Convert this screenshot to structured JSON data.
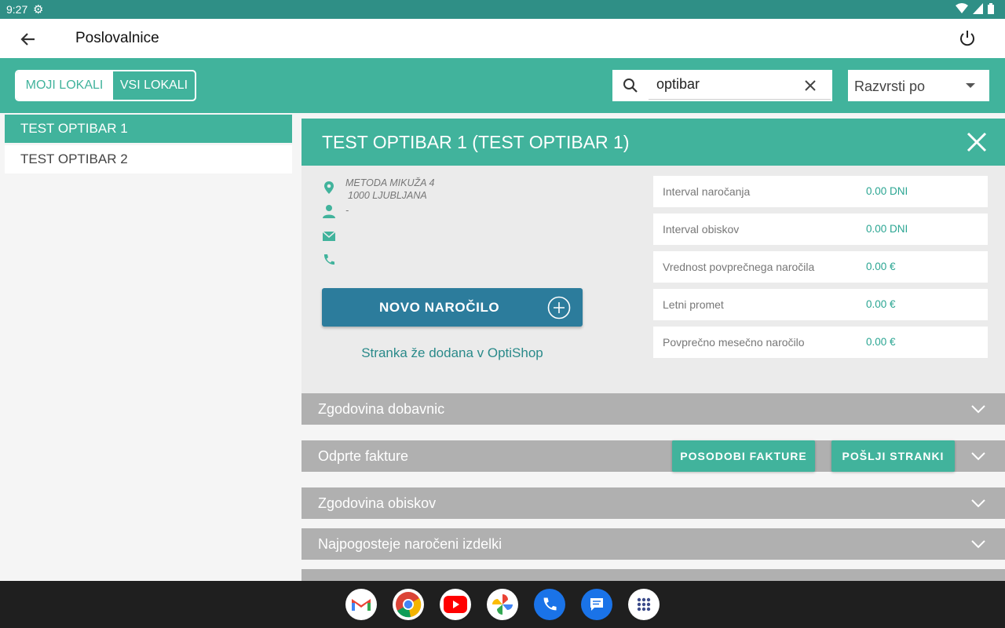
{
  "status_bar": {
    "time": "9:27"
  },
  "app_bar": {
    "title": "Poslovalnice"
  },
  "toolbar": {
    "tabs": [
      "MOJI LOKALI",
      "VSI LOKALI"
    ],
    "search_value": "optibar",
    "sort_label": "Razvrsti po"
  },
  "list": {
    "items": [
      "TEST OPTIBAR 1",
      "TEST OPTIBAR 2"
    ]
  },
  "detail": {
    "title": "TEST OPTIBAR 1 (TEST OPTIBAR 1)",
    "address_line1": "METODA MIKUŽA 4",
    "address_line2": "1000 LJUBLJANA",
    "contact_person": "-",
    "email": "",
    "phone": "",
    "order_button": "NOVO NAROČILO",
    "status_link": "Stranka že dodana v OptiShop",
    "stats": [
      {
        "label": "Interval naročanja",
        "value": "0.00 DNI"
      },
      {
        "label": "Interval obiskov",
        "value": "0.00 DNI"
      },
      {
        "label": "Vrednost povprečnega naročila",
        "value": "0.00 €"
      },
      {
        "label": "Letni promet",
        "value": "0.00 €"
      },
      {
        "label": "Povprečno mesečno naročilo",
        "value": "0.00 €"
      }
    ]
  },
  "sections": [
    {
      "title": "Zgodovina dobavnic"
    },
    {
      "title": "Odprte fakture",
      "buttons": [
        "POSODOBI FAKTURE",
        "POŠLJI STRANKI"
      ]
    },
    {
      "title": "Zgodovina obiskov"
    },
    {
      "title": "Najpogosteje naročeni izdelki"
    }
  ],
  "dock": {
    "apps": [
      "gmail-icon",
      "chrome-icon",
      "youtube-icon",
      "photos-icon",
      "phone-icon",
      "messages-icon",
      "apps-grid-icon"
    ]
  },
  "colors": {
    "accent": "#41b39c",
    "status_bar": "#2f8f86",
    "order_button": "#2c7c9c",
    "section_bar": "#b0b0b0"
  }
}
